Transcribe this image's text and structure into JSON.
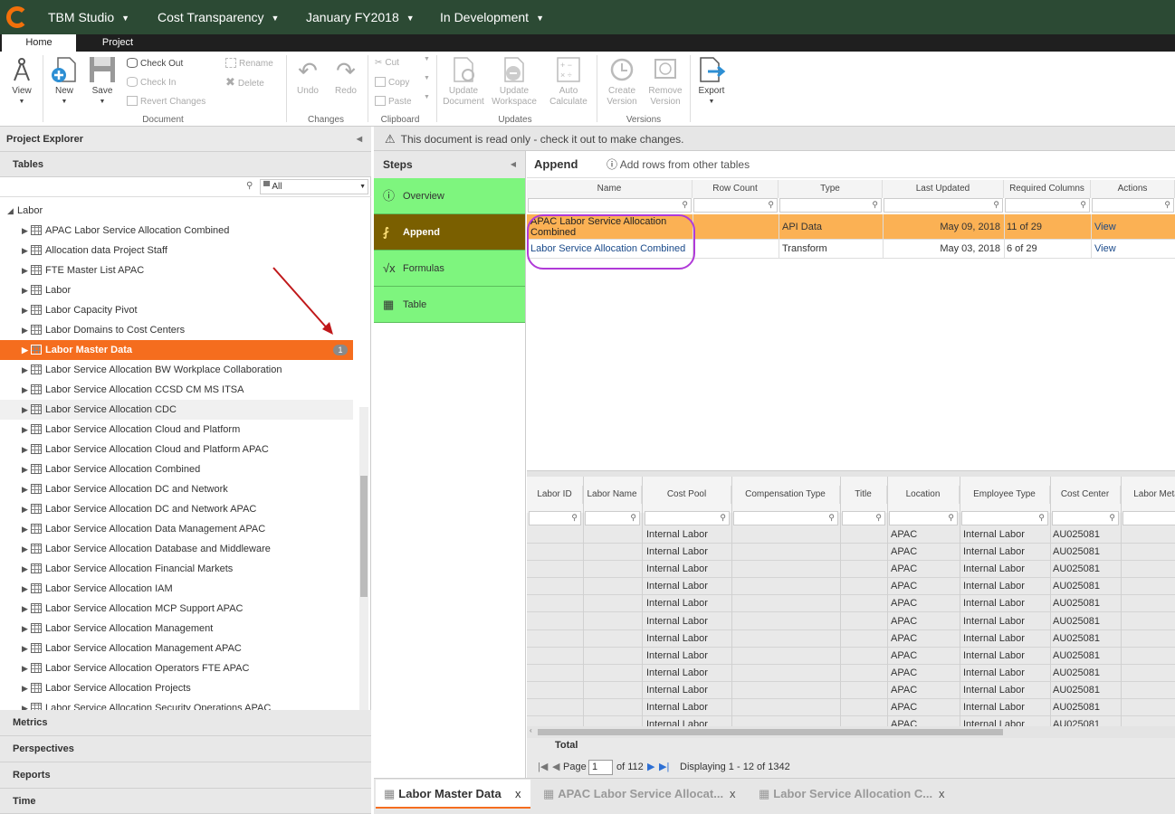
{
  "topbar": {
    "app": "TBM Studio",
    "model": "Cost Transparency",
    "period": "January FY2018",
    "scenario": "In Development"
  },
  "ribbon_tabs": {
    "home": "Home",
    "project": "Project"
  },
  "ribbon": {
    "view": "View",
    "new": "New",
    "save": "Save",
    "check_out": "Check Out",
    "check_in": "Check In",
    "revert": "Revert Changes",
    "rename": "Rename",
    "delete": "Delete",
    "undo": "Undo",
    "redo": "Redo",
    "cut": "Cut",
    "copy": "Copy",
    "paste": "Paste",
    "update_doc_1": "Update",
    "update_doc_2": "Document",
    "update_ws_1": "Update",
    "update_ws_2": "Workspace",
    "auto_1": "Auto",
    "auto_2": "Calculate",
    "create_1": "Create",
    "create_2": "Version",
    "remove_1": "Remove",
    "remove_2": "Version",
    "export": "Export",
    "groups": {
      "document": "Document",
      "changes": "Changes",
      "clipboard": "Clipboard",
      "updates": "Updates",
      "versions": "Versions"
    }
  },
  "explorer": {
    "title": "Project Explorer",
    "tables": "Tables",
    "filter_value": "All",
    "root": "Labor",
    "items": [
      "APAC Labor Service Allocation Combined",
      "Allocation data Project Staff",
      "FTE Master List APAC",
      "Labor",
      "Labor Capacity Pivot",
      "Labor Domains to Cost Centers",
      "Labor Master Data",
      "Labor Service Allocation BW Workplace Collaboration",
      "Labor Service Allocation CCSD CM MS ITSA",
      "Labor Service Allocation CDC",
      "Labor Service Allocation Cloud and Platform",
      "Labor Service Allocation Cloud and Platform APAC",
      "Labor Service Allocation Combined",
      "Labor Service Allocation DC and Network",
      "Labor Service Allocation DC and Network APAC",
      "Labor Service Allocation Data Management APAC",
      "Labor Service Allocation Database and Middleware",
      "Labor Service Allocation Financial Markets",
      "Labor Service Allocation IAM",
      "Labor Service Allocation MCP Support APAC",
      "Labor Service Allocation Management",
      "Labor Service Allocation Management APAC",
      "Labor Service Allocation Operators FTE APAC",
      "Labor Service Allocation Projects",
      "Labor Service Allocation Security Operations APAC"
    ],
    "selected_badge": "1",
    "sections": [
      "Metrics",
      "Perspectives",
      "Reports",
      "Time"
    ]
  },
  "readonly_msg": "This document is read only - check it out to make changes.",
  "steps": {
    "title": "Steps",
    "items": [
      "Overview",
      "Append",
      "Formulas",
      "Table"
    ]
  },
  "append": {
    "title": "Append",
    "add_rows": "Add rows from other tables",
    "columns": [
      "Name",
      "Row Count",
      "Type",
      "Last Updated",
      "Required Columns",
      "Actions"
    ],
    "rows": [
      {
        "name": "APAC Labor Service Allocation Combined",
        "row_count": "",
        "type": "API Data",
        "updated": "May 09, 2018",
        "required": "11 of 29",
        "action": "View"
      },
      {
        "name": "Labor Service Allocation Combined",
        "row_count": "",
        "type": "Transform",
        "updated": "May 03, 2018",
        "required": "6 of 29",
        "action": "View"
      }
    ]
  },
  "preview": {
    "columns": [
      "Labor ID",
      "Labor Name",
      "Cost Pool",
      "Compensation Type",
      "Title",
      "Location",
      "Employee Type",
      "Cost Center",
      "Labor Meta"
    ],
    "row": {
      "cost_pool": "Internal Labor",
      "location": "APAC",
      "employee_type": "Internal Labor",
      "cost_center": "AU025081"
    },
    "total_label": "Total",
    "pager": {
      "page_label": "Page",
      "page": "1",
      "of": "of 112",
      "displaying": "Displaying 1 - 12 of 1342"
    }
  },
  "bottom_tabs": [
    "Labor Master Data",
    "APAC Labor Service Allocat...",
    "Labor Service Allocation C..."
  ],
  "colors": {
    "topbar": "#2c4a34",
    "selected": "#f56d1e",
    "step": "#7ef57e",
    "step_active": "#7a5f00",
    "highlight_row": "#fbb154",
    "annotation": "#b03ad8",
    "arrow": "#c0181a"
  }
}
